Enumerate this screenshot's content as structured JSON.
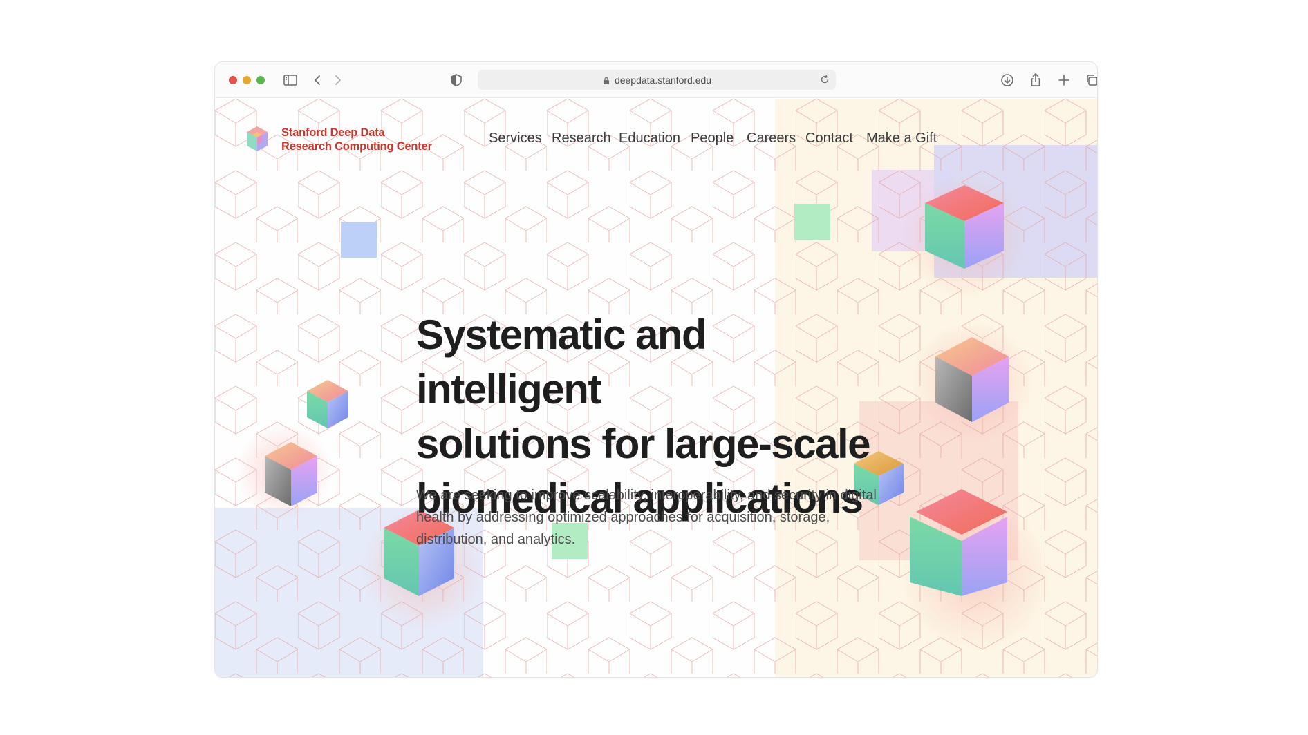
{
  "browser": {
    "url": "deepdata.stanford.edu",
    "traffic_lights": {
      "close": "#e0534c",
      "minimize": "#e3a935",
      "zoom": "#57b94c"
    }
  },
  "site": {
    "logo_line1": "Stanford Deep Data",
    "logo_line2": "Research Computing Center",
    "brand_color": "#c6372e"
  },
  "nav": {
    "items": [
      "Services",
      "Research",
      "Education",
      "People",
      "Careers",
      "Contact",
      "Make a Gift"
    ]
  },
  "hero": {
    "title_line1": "Systematic and intelligent",
    "title_line2": "solutions for large-scale",
    "title_line3": "biomedical applications",
    "subtitle_line1": "We are seeking to improve scalability, interoperability, and security in digital",
    "subtitle_line2": "health by addressing optimized approaches for acquisition, storage,",
    "subtitle_line3": "distribution, and analytics."
  },
  "icons": {
    "sidebar": "sidebar-toggle-icon",
    "back": "chevron-left-icon",
    "forward": "chevron-right-icon",
    "privacy": "shield-icon",
    "lock": "lock-icon",
    "reload": "reload-icon",
    "download": "download-icon",
    "share": "share-icon",
    "new_tab": "plus-icon",
    "tabs": "tab-overview-icon"
  }
}
